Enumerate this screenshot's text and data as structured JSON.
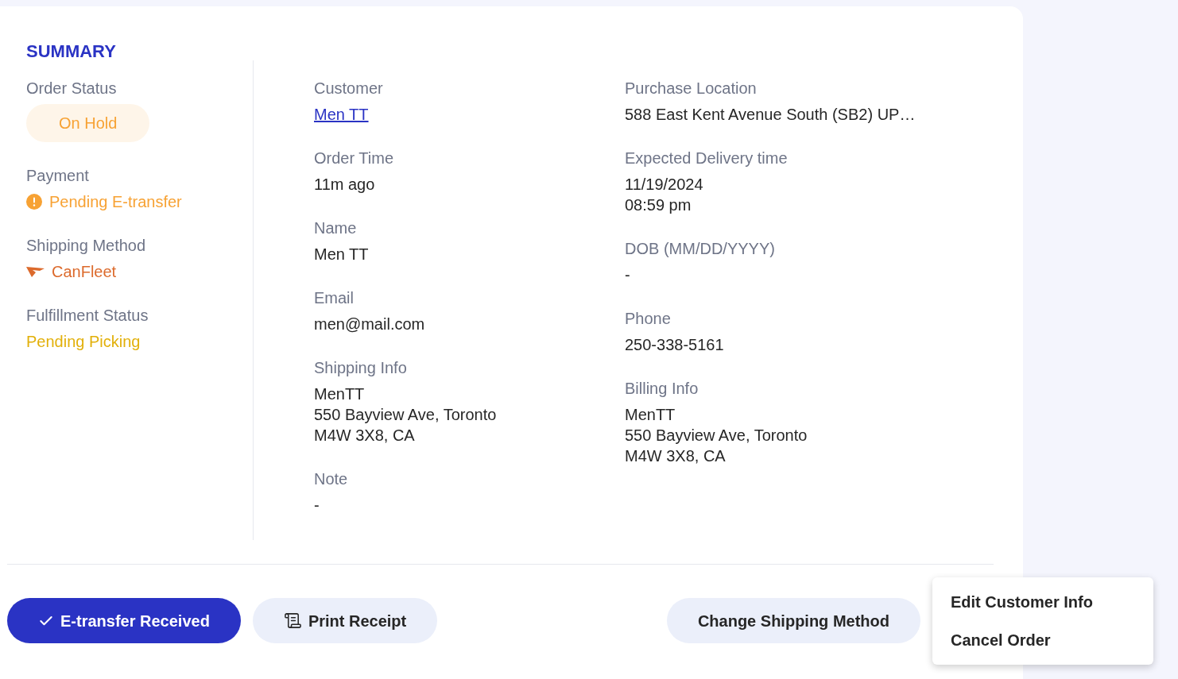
{
  "summary": {
    "title": "SUMMARY",
    "fields": [
      {
        "label": "Order Status",
        "kind": "badge",
        "value": "On Hold",
        "color": "#f7a234"
      },
      {
        "label": "Payment",
        "kind": "alert",
        "value": "Pending E-transfer",
        "color": "#f7a234"
      },
      {
        "label": "Shipping Method",
        "kind": "carrier",
        "value": "CanFleet",
        "color": "#dc6a2c"
      },
      {
        "label": "Fulfillment Status",
        "kind": "text",
        "value": "Pending Picking",
        "color": "#e2b00a"
      }
    ]
  },
  "details": {
    "columns": [
      [
        {
          "label": "Customer",
          "kind": "link",
          "lines": [
            "Men TT"
          ]
        },
        {
          "label": "Order Time",
          "kind": "text",
          "lines": [
            "11m ago"
          ]
        },
        {
          "label": "Name",
          "kind": "text",
          "lines": [
            "Men TT"
          ]
        },
        {
          "label": "Email",
          "kind": "text",
          "lines": [
            "men@mail.com"
          ]
        },
        {
          "label": "Shipping Info",
          "kind": "text",
          "lines": [
            "MenTT",
            "550 Bayview Ave, Toronto",
            "M4W 3X8, CA"
          ]
        },
        {
          "label": "Note",
          "kind": "text",
          "lines": [
            "-"
          ]
        }
      ],
      [
        {
          "label": "Purchase Location",
          "kind": "text",
          "lines": [
            "588 East Kent Avenue South (SB2) UP…"
          ]
        },
        {
          "label": "Expected Delivery time",
          "kind": "text",
          "lines": [
            "11/19/2024",
            "08:59 pm"
          ]
        },
        {
          "label": "DOB (MM/DD/YYYY)",
          "kind": "text",
          "lines": [
            "-"
          ]
        },
        {
          "label": "Phone",
          "kind": "text",
          "lines": [
            "250-338-5161"
          ]
        },
        {
          "label": "Billing Info",
          "kind": "text",
          "lines": [
            "MenTT",
            "550 Bayview Ave, Toronto",
            "M4W 3X8, CA"
          ]
        }
      ]
    ]
  },
  "actions": [
    {
      "label": "E-transfer Received",
      "kind": "primary"
    },
    {
      "label": "Print Receipt",
      "kind": "print"
    },
    {
      "label": "Change Shipping Method",
      "kind": "secondary"
    }
  ],
  "menu": {
    "items": [
      "Edit Customer Info",
      "Cancel Order"
    ]
  }
}
